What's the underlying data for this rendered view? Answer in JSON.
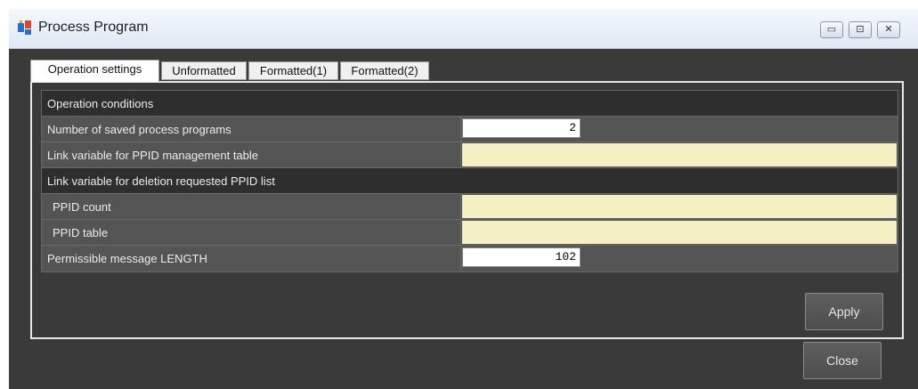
{
  "window": {
    "title": "Process Program",
    "controls": {
      "minimize": "▭",
      "maximize": "⊡",
      "close": "✕"
    }
  },
  "tabs": [
    {
      "label": "Operation settings",
      "active": true
    },
    {
      "label": "Unformatted",
      "active": false
    },
    {
      "label": "Formatted(1)",
      "active": false
    },
    {
      "label": "Formatted(2)",
      "active": false
    }
  ],
  "settings": {
    "section_header": "Operation conditions",
    "saved_programs_label": "Number of saved process programs",
    "saved_programs_value": "2",
    "link_ppid_table_label": "Link variable for PPID management table",
    "deletion_list_label": "Link variable for deletion requested PPID list",
    "ppid_count_label": "PPID count",
    "ppid_table_label": "PPID table",
    "message_length_label": "Permissible message LENGTH",
    "message_length_value": "102"
  },
  "buttons": {
    "apply": "Apply",
    "close": "Close"
  },
  "colors": {
    "background": "#3a3a3a",
    "header_row": "#2e2e2e",
    "row": "#545454",
    "variable_field": "#f5f0c4"
  }
}
